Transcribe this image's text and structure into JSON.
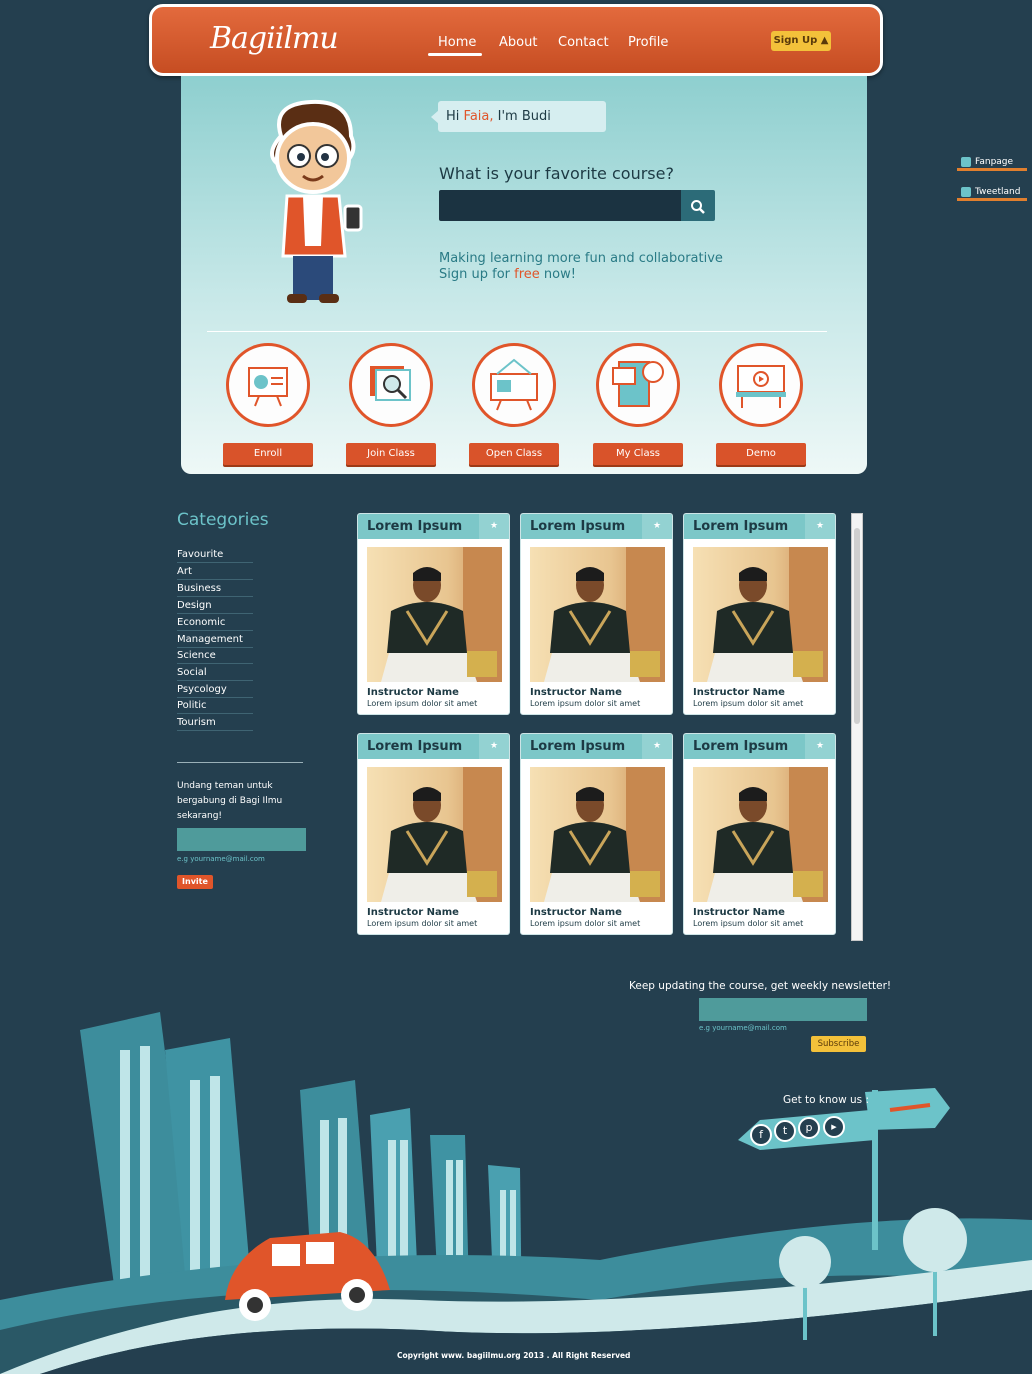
{
  "header": {
    "logo": "Bagiilmu",
    "nav": [
      "Home",
      "About",
      "Contact",
      "Profile"
    ],
    "signup_label": "Sign Up ▲"
  },
  "hero": {
    "greeting_prefix": "Hi ",
    "greeting_name": "Faia,",
    "greeting_suffix": " I'm Budi",
    "question": "What is your favorite course?",
    "search_value": "",
    "tagline_line1": "Making learning more fun and collaborative",
    "tagline_line2_prefix": "Sign up for ",
    "tagline_free": "free",
    "tagline_line2_suffix": "  now!"
  },
  "courses": [
    "Enroll",
    "Join Class",
    "Open Class",
    "My Class",
    "Demo"
  ],
  "side_tabs": [
    "Fanpage",
    "Tweetland"
  ],
  "categories": {
    "title": "Categories",
    "items": [
      "Favourite",
      "Art",
      "Business",
      "Design",
      "Economic",
      "Management",
      "Science",
      "Social",
      "Psycology",
      "Politic",
      "Tourism"
    ]
  },
  "invite": {
    "text": "Undang teman untuk bergabung di Bagi Ilmu sekarang!",
    "input_value": "",
    "hint": "e.g yourname@mail.com",
    "button": "Invite"
  },
  "cards": [
    {
      "title": "Lorem Ipsum",
      "name": "Instructor Name",
      "desc": "Lorem ipsum dolor sit amet"
    },
    {
      "title": "Lorem Ipsum",
      "name": "Instructor Name",
      "desc": "Lorem ipsum dolor sit amet"
    },
    {
      "title": "Lorem Ipsum",
      "name": "Instructor Name",
      "desc": "Lorem ipsum dolor sit amet"
    },
    {
      "title": "Lorem Ipsum",
      "name": "Instructor Name",
      "desc": "Lorem ipsum dolor sit amet"
    },
    {
      "title": "Lorem Ipsum",
      "name": "Instructor Name",
      "desc": "Lorem ipsum dolor sit amet"
    },
    {
      "title": "Lorem Ipsum",
      "name": "Instructor Name",
      "desc": "Lorem ipsum dolor sit amet"
    }
  ],
  "newsletter": {
    "text": "Keep updating the course, get weekly newsletter!",
    "input_value": "",
    "hint": "e.g yourname@mail.com",
    "button": "Subscribe"
  },
  "social": {
    "label": "Get to know us :",
    "icons": [
      "facebook-icon",
      "twitter-icon",
      "pinterest-icon",
      "youtube-icon"
    ]
  },
  "footer": {
    "copyright": "Copyright www. bagiilmu.org 2013 . All Right Reserved"
  },
  "colors": {
    "background": "#243f4f",
    "accent": "#e0552a",
    "teal": "#6cc3c9",
    "yellow": "#f3c13a"
  }
}
